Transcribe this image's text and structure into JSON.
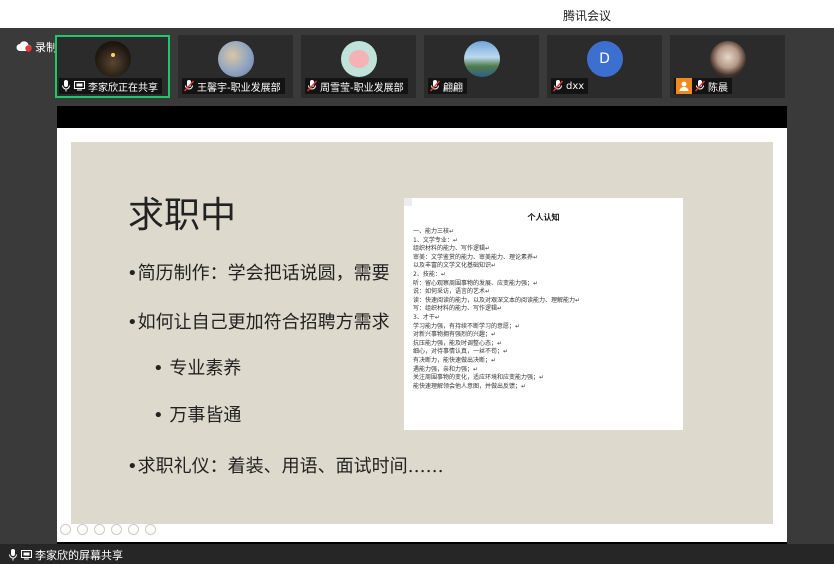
{
  "window": {
    "title": "腾讯会议"
  },
  "recording": {
    "label": "录制中"
  },
  "participants": [
    {
      "name": "李家欣正在共享",
      "active": true,
      "sharing": true
    },
    {
      "name": "王馨宇-职业发展部",
      "active": false
    },
    {
      "name": "周雪莹-职业发展部",
      "active": false
    },
    {
      "name": "翩翩",
      "active": false
    },
    {
      "name": "dxx",
      "active": false,
      "initial": "D"
    },
    {
      "name": "陈晨",
      "active": false
    }
  ],
  "slide": {
    "title": "求职中",
    "bullets": [
      "•简历制作：学会把话说圆，需要",
      "•如何让自己更加符合招聘方需求",
      "• 专业素养",
      "• 万事皆通",
      "•求职礼仪：着装、用语、面试时间……"
    ]
  },
  "document": {
    "title": "个人认知",
    "lines": [
      "一、能力三核↵",
      "1、文学专业：↵",
      "组织材料的能力、写作逻辑↵",
      "审美：文学鉴赏的能力、审美能力、理论素养↵",
      "以及丰富的文学文化基础知识↵",
      "2、技能：↵",
      "听：留心观察周围事物的发展、应变能力强；↵",
      "说：如何采访，语言的艺术↵",
      "读：快速阅读的能力，以及对艰深文本的阅读能力、理解能力↵",
      "写：组织材料的能力、写作逻辑↵",
      "3、才干↵",
      "学习能力强，有持续不断学习的意愿；↵",
      "对新兴事物拥有强烈的兴趣；↵",
      "抗压能力强，能及时调整心态；↵",
      "细心，对待事情认真，一丝不苟；↵",
      "有决断力，能快速做出决断；↵",
      "遇能力强，亲和力强；↵",
      "关注周围事物的变化，适应环境和应变能力强；↵",
      "能快速理解领会他人意图，并做出反馈；↵"
    ]
  },
  "footer": {
    "label": "李家欣的屏幕共享"
  },
  "colors": {
    "active_border": "#1fc76a",
    "avatar_blue": "#3d6fd1",
    "orange": "#f08a20"
  }
}
